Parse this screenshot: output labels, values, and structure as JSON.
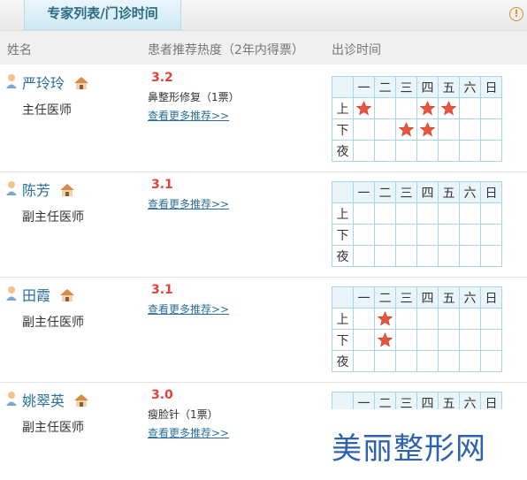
{
  "tab_title": "专家列表/门诊时间",
  "info_icon": "!",
  "headers": {
    "name": "姓名",
    "popularity": "患者推荐热度（2年内得票）",
    "schedule": "出诊时间"
  },
  "days": [
    "一",
    "二",
    "三",
    "四",
    "五",
    "六",
    "日"
  ],
  "periods": [
    "上",
    "下",
    "夜"
  ],
  "doctors": [
    {
      "name": "严玲玲",
      "title": "主任医师",
      "score": "3.2",
      "recommend": "鼻整形修复（1票）",
      "more": "查看更多推荐>>",
      "schedule": {
        "上": [
          1,
          4,
          5
        ],
        "下": [
          3,
          4
        ],
        "夜": []
      }
    },
    {
      "name": "陈芳",
      "title": "副主任医师",
      "score": "3.1",
      "recommend": "",
      "more": "查看更多推荐>>",
      "schedule": {
        "上": [],
        "下": [],
        "夜": []
      }
    },
    {
      "name": "田霞",
      "title": "副主任医师",
      "score": "3.1",
      "recommend": "",
      "more": "查看更多推荐>>",
      "schedule": {
        "上": [
          2
        ],
        "下": [
          2
        ],
        "夜": []
      }
    },
    {
      "name": "姚翠英",
      "title": "副主任医师",
      "score": "3.0",
      "recommend": "瘦脸针（1票）",
      "more": "查看更多推荐>>",
      "schedule": {
        "上": [],
        "下": [],
        "夜": []
      }
    }
  ],
  "watermark": "美丽整形网",
  "colors": {
    "link": "#2a6f9a",
    "score": "#e0443c",
    "grid": "#a8d6e8",
    "star": "#e8553f"
  },
  "icons": [
    "person-icon",
    "home-icon",
    "star-icon",
    "info-icon"
  ]
}
